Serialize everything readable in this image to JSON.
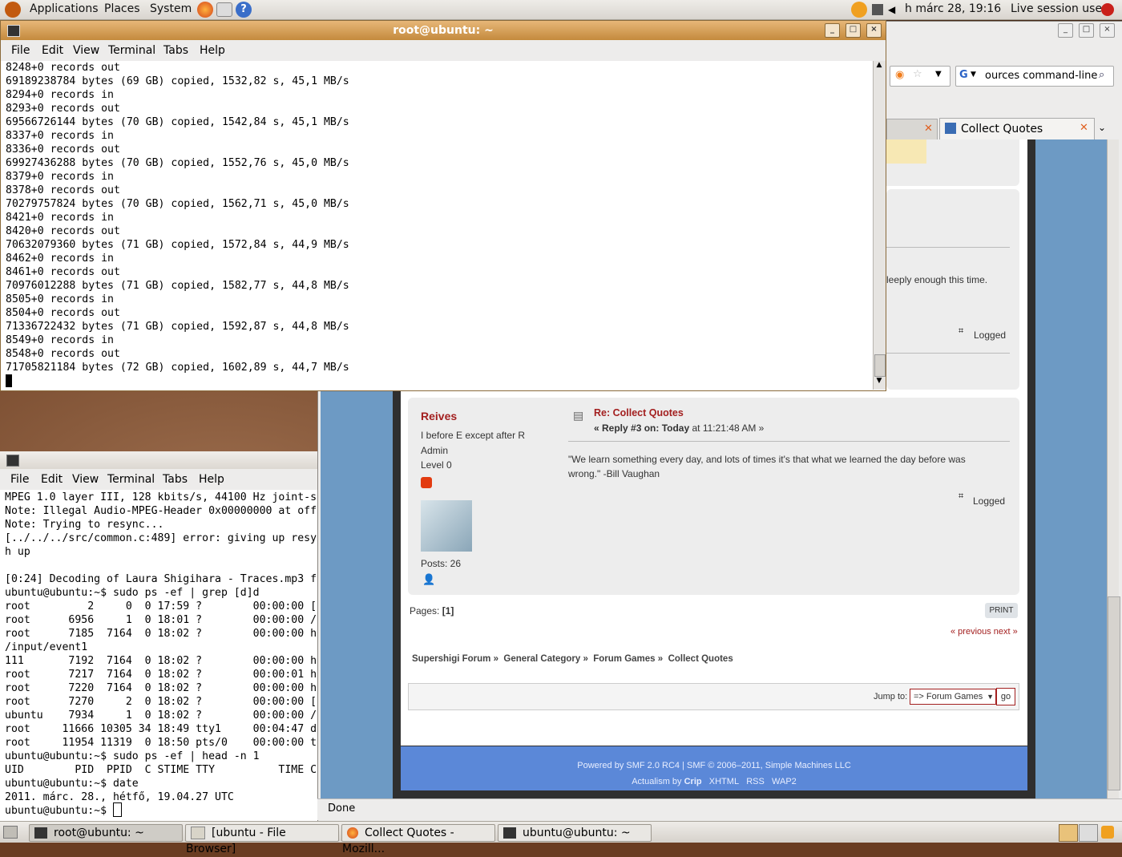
{
  "top_panel": {
    "menus": [
      "Applications",
      "Places",
      "System"
    ],
    "clock": "h márc 28, 19:16",
    "session": "Live session user"
  },
  "terminal_main": {
    "title": "root@ubuntu: ~",
    "menu": [
      "File",
      "Edit",
      "View",
      "Terminal",
      "Tabs",
      "Help"
    ],
    "output": "8248+0 records out\n69189238784 bytes (69 GB) copied, 1532,82 s, 45,1 MB/s\n8294+0 records in\n8293+0 records out\n69566726144 bytes (70 GB) copied, 1542,84 s, 45,1 MB/s\n8337+0 records in\n8336+0 records out\n69927436288 bytes (70 GB) copied, 1552,76 s, 45,0 MB/s\n8379+0 records in\n8378+0 records out\n70279757824 bytes (70 GB) copied, 1562,71 s, 45,0 MB/s\n8421+0 records in\n8420+0 records out\n70632079360 bytes (71 GB) copied, 1572,84 s, 44,9 MB/s\n8462+0 records in\n8461+0 records out\n70976012288 bytes (71 GB) copied, 1582,77 s, 44,8 MB/s\n8505+0 records in\n8504+0 records out\n71336722432 bytes (71 GB) copied, 1592,87 s, 44,8 MB/s\n8549+0 records in\n8548+0 records out\n71705821184 bytes (72 GB) copied, 1602,89 s, 44,7 MB/s"
  },
  "terminal_second": {
    "menu": [
      "File",
      "Edit",
      "View",
      "Terminal",
      "Tabs",
      "Help"
    ],
    "output": "MPEG 1.0 layer III, 128 kbits/s, 44100 Hz joint-s\nNote: Illegal Audio-MPEG-Header 0x00000000 at off\nNote: Trying to resync...\n[../../../src/common.c:489] error: giving up resy\nh up\n\n[0:24] Decoding of Laura Shigihara - Traces.mp3 f\nubuntu@ubuntu:~$ sudo ps -ef | grep [d]d\nroot         2     0  0 17:59 ?        00:00:00 [\nroot      6956     1  0 18:01 ?        00:00:00 /\nroot      7185  7164  0 18:02 ?        00:00:00 h\n/input/event1\n111       7192  7164  0 18:02 ?        00:00:00 h\nroot      7217  7164  0 18:02 ?        00:00:01 h\nroot      7220  7164  0 18:02 ?        00:00:00 h\nroot      7270     2  0 18:02 ?        00:00:00 [\nubuntu    7934     1  0 18:02 ?        00:00:00 /\nroot     11666 10305 34 18:49 tty1     00:04:47 d\nroot     11954 11319  0 18:50 pts/0    00:00:00 t\nubuntu@ubuntu:~$ sudo ps -ef | head -n 1\nUID        PID  PPID  C STIME TTY          TIME C\nubuntu@ubuntu:~$ date\n2011. márc. 28., hétfő, 19.04.27 UTC\nubuntu@ubuntu:~$ "
  },
  "browser": {
    "search_value": "ources command-line",
    "tab_title": "Collect Quotes",
    "status": "Done",
    "partial_text_1": "leeply enough this time.",
    "logged_1": "Logged",
    "post": {
      "author": "Reives",
      "member_text": "I before E except after R",
      "group": "Admin",
      "level": "Level 0",
      "posts": "Posts: 26",
      "subject": "Re: Collect Quotes",
      "reply_prefix": "« Reply #3 on:",
      "reply_today": "Today",
      "reply_time": "at 11:21:48 AM »",
      "body": "\"We learn something every day, and lots of times it's that what we learned the day before was wrong.\" -Bill Vaughan",
      "logged": "Logged"
    },
    "pages_label": "Pages: ",
    "pages_current": "[1]",
    "print": "PRINT",
    "prev_next": "« previous next »",
    "breadcrumb": [
      "Supershigi Forum »",
      "General Category »",
      "Forum Games »",
      "Collect Quotes"
    ],
    "jump_label": "Jump to:",
    "jump_value": "=> Forum Games",
    "go": "go",
    "footer_line1": "Powered by SMF 2.0 RC4 | SMF © 2006–2011, Simple Machines LLC",
    "footer_line2_prefix": "Actualism by",
    "footer_line2_name": "Crip",
    "footer_links": [
      "XHTML",
      "RSS",
      "WAP2"
    ]
  },
  "taskbar": {
    "tasks": [
      "root@ubuntu: ~",
      "[ubuntu - File Browser]",
      "Collect Quotes - Mozill...",
      "ubuntu@ubuntu: ~"
    ]
  }
}
